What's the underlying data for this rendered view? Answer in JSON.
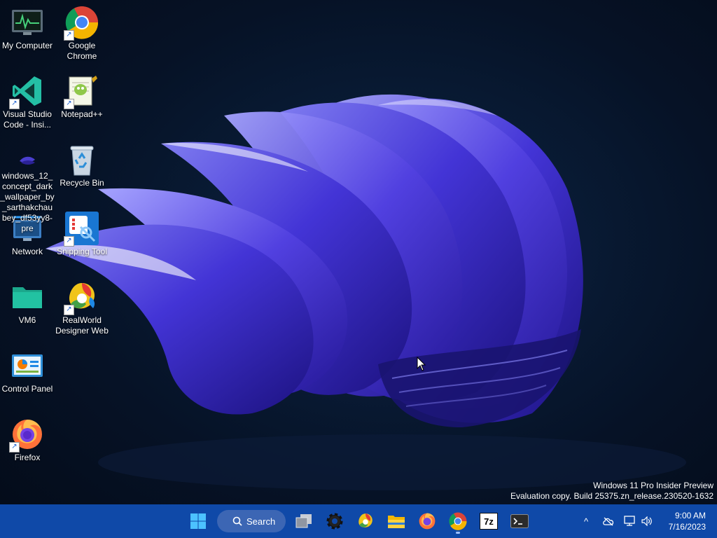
{
  "desktop": {
    "icons": [
      {
        "label": "My Computer"
      },
      {
        "label": "Google Chrome"
      },
      {
        "label": "Visual Studio Code - Insi..."
      },
      {
        "label": "Notepad++"
      },
      {
        "label": "windows_12_concept_dark_wallpaper_by_sarthakchaubey_df53yy8-pre"
      },
      {
        "label": "Recycle Bin"
      },
      {
        "label": "Network"
      },
      {
        "label": "Snipping Tool"
      },
      {
        "label": "VM6"
      },
      {
        "label": "RealWorld Designer Web"
      },
      {
        "label": "Control Panel"
      },
      {
        "label": "Firefox"
      }
    ],
    "watermark": {
      "line1": "Windows 11 Pro Insider Preview",
      "line2": "Evaluation copy. Build 25375.zn_release.230520-1632"
    }
  },
  "taskbar": {
    "search_label": "Search",
    "apps": [
      {
        "icon": "start-icon"
      },
      {
        "icon": "task-view-icon"
      },
      {
        "icon": "settings-gear-icon"
      },
      {
        "icon": "realworld-designer-icon"
      },
      {
        "icon": "file-explorer-icon"
      },
      {
        "icon": "firefox-icon"
      },
      {
        "icon": "chrome-icon",
        "running": true
      },
      {
        "icon": "7zip-icon",
        "label": "7z"
      },
      {
        "icon": "terminal-icon"
      }
    ],
    "tray": {
      "chevron": "^",
      "time": "9:00 AM",
      "date": "7/16/2023"
    }
  },
  "colors": {
    "taskbar": "#0f49a8",
    "wallpaper_dark": "#061226",
    "flower": "#3d2fc8"
  }
}
